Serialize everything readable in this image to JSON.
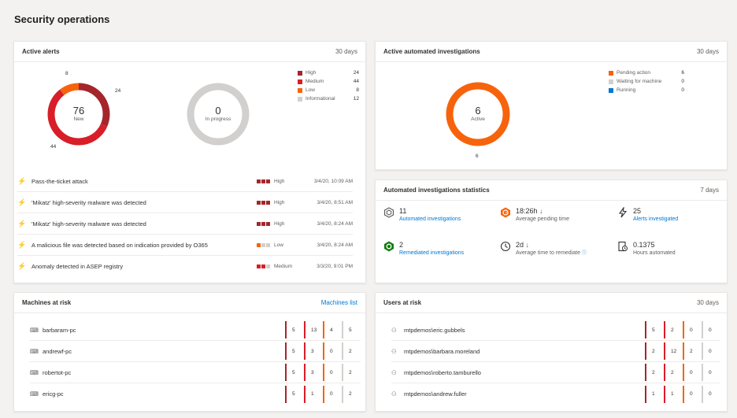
{
  "page_title": "Security operations",
  "colors": {
    "high": "#a4262c",
    "medium": "#d81e28",
    "low": "#f7630c",
    "informational": "#d2d0ce",
    "pending": "#f7630c",
    "waiting": "#d2d0ce",
    "running": "#0078d4"
  },
  "active_alerts": {
    "title": "Active alerts",
    "range": "30 days",
    "new_total": "76",
    "new_label": "New",
    "callouts": {
      "high": "24",
      "low": "8",
      "medium": "44"
    },
    "in_progress_total": "0",
    "in_progress_label": "In progress",
    "legend": [
      {
        "label": "High",
        "count": "24",
        "color": "#a4262c"
      },
      {
        "label": "Medium",
        "count": "44",
        "color": "#d81e28"
      },
      {
        "label": "Low",
        "count": "8",
        "color": "#f7630c"
      },
      {
        "label": "Informational",
        "count": "12",
        "color": "#d2d0ce"
      }
    ],
    "alerts": [
      {
        "title": "Pass-the-ticket attack",
        "severity": "High",
        "time": "3/4/20, 10:09 AM"
      },
      {
        "title": "'Mikatz' high-severity malware was detected",
        "severity": "High",
        "time": "3/4/20, 8:51 AM"
      },
      {
        "title": "'Mikatz' high-severity malware was detected",
        "severity": "High",
        "time": "3/4/20, 8:24 AM"
      },
      {
        "title": "A malicious file was detected based on indication provided by O365",
        "severity": "Low",
        "time": "3/4/20, 8:24 AM"
      },
      {
        "title": "Anomaly detected in ASEP registry",
        "severity": "Medium",
        "time": "3/3/20, 9:01 PM"
      }
    ]
  },
  "auto_investigations": {
    "title": "Active automated investigations",
    "range": "30 days",
    "total": "6",
    "total_label": "Active",
    "callout": "6",
    "legend": [
      {
        "label": "Pending action",
        "count": "6",
        "color": "#f7630c"
      },
      {
        "label": "Waiting for machine",
        "count": "0",
        "color": "#d2d0ce"
      },
      {
        "label": "Running",
        "count": "0",
        "color": "#0078d4"
      }
    ]
  },
  "stats": {
    "title": "Automated investigations statistics",
    "range": "7 days",
    "items": [
      {
        "value": "11",
        "label": "Automated investigations"
      },
      {
        "value": "18:26h",
        "label": "Average pending time"
      },
      {
        "value": "25",
        "label": "Alerts investigated"
      },
      {
        "value": "2",
        "label": "Remediated investigations"
      },
      {
        "value": "2d",
        "label": "Average time to remediate"
      },
      {
        "value": "0.1375",
        "label": "Hours automated"
      }
    ]
  },
  "machines": {
    "title": "Machines at risk",
    "link": "Machines list",
    "rows": [
      {
        "name": "barbaram-pc",
        "counts": [
          "5",
          "13",
          "4",
          "5"
        ]
      },
      {
        "name": "andrewf-pc",
        "counts": [
          "5",
          "3",
          "0",
          "2"
        ]
      },
      {
        "name": "robertot-pc",
        "counts": [
          "5",
          "3",
          "0",
          "2"
        ]
      },
      {
        "name": "ericg-pc",
        "counts": [
          "5",
          "1",
          "0",
          "2"
        ]
      }
    ]
  },
  "users": {
    "title": "Users at risk",
    "range": "30 days",
    "rows": [
      {
        "name": "mtpdemos\\eric.gubbels",
        "counts": [
          "5",
          "2",
          "0",
          "0"
        ]
      },
      {
        "name": "mtpdemos\\barbara.moreland",
        "counts": [
          "2",
          "12",
          "2",
          "0"
        ]
      },
      {
        "name": "mtpdemos\\roberto.tamburello",
        "counts": [
          "2",
          "2",
          "0",
          "0"
        ]
      },
      {
        "name": "mtpdemos\\andrew.fuller",
        "counts": [
          "1",
          "1",
          "0",
          "0"
        ]
      }
    ]
  }
}
